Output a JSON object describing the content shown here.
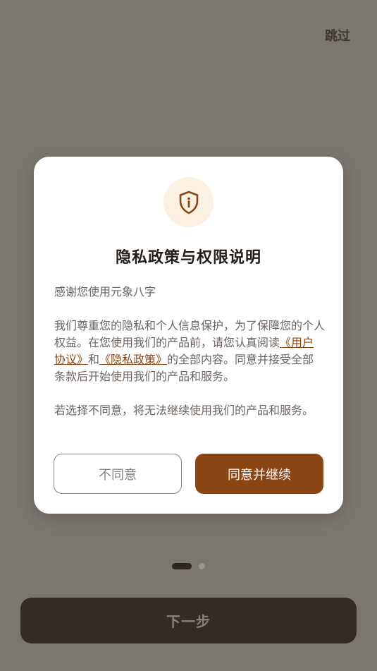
{
  "header": {
    "skip_label": "跳过"
  },
  "dialog": {
    "icon": "shield-info-icon",
    "title": "隐私政策与权限说明",
    "greeting": "感谢您使用元象八字",
    "para1_before": "我们尊重您的隐私和个人信息保护，为了保障您的个人权益。在您使用我们的产品前，请您认真阅读",
    "user_agreement_link": "《用户协议》",
    "para1_and": "和",
    "privacy_policy_link": "《隐私政策》",
    "para1_after": "的全部内容。同意并接受全部条款后开始使用我们的产品和服务。",
    "para2": "若选择不同意，将无法继续使用我们的产品和服务。",
    "disagree_label": "不同意",
    "agree_label": "同意并继续"
  },
  "pager": {
    "current_page": 1,
    "total_pages": 2
  },
  "footer": {
    "next_label": "下一步"
  },
  "colors": {
    "accent": "#8b4513",
    "overlay": "#7b766f",
    "icon_bg": "#fbf1e3"
  }
}
